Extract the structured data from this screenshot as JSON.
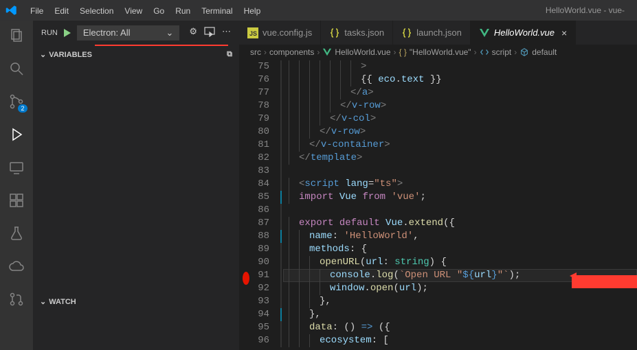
{
  "window_title": "HelloWorld.vue - vue-",
  "menu": [
    "File",
    "Edit",
    "Selection",
    "View",
    "Go",
    "Run",
    "Terminal",
    "Help"
  ],
  "activity_badge": "2",
  "run": {
    "label": "RUN",
    "config": "Electron: All"
  },
  "sections": {
    "variables": "VARIABLES",
    "watch": "WATCH"
  },
  "tabs": [
    {
      "label": "vue.config.js",
      "icon": "js",
      "active": false
    },
    {
      "label": "tasks.json",
      "icon": "json",
      "active": false
    },
    {
      "label": "launch.json",
      "icon": "json",
      "active": false
    },
    {
      "label": "HelloWorld.vue",
      "icon": "vue",
      "active": true
    }
  ],
  "breadcrumb": [
    "src",
    "components",
    "HelloWorld.vue",
    "\"HelloWorld.vue\"",
    "script",
    "default"
  ],
  "code": {
    "start": 75,
    "breakpoint_line": 91,
    "highlighted_line": 91,
    "modified_lines": [
      85,
      88,
      94
    ],
    "lines": [
      {
        "n": 75,
        "i": 7,
        "tokens": [
          [
            "c-pun",
            ">"
          ]
        ]
      },
      {
        "n": 76,
        "i": 7,
        "tokens": [
          [
            "c-plain",
            "{{ "
          ],
          [
            "c-var",
            "eco"
          ],
          [
            "c-plain",
            "."
          ],
          [
            "c-var",
            "text"
          ],
          [
            "c-plain",
            " }}"
          ]
        ]
      },
      {
        "n": 77,
        "i": 6,
        "tokens": [
          [
            "c-pun",
            "</"
          ],
          [
            "c-tag",
            "a"
          ],
          [
            "c-pun",
            ">"
          ]
        ]
      },
      {
        "n": 78,
        "i": 5,
        "tokens": [
          [
            "c-pun",
            "</"
          ],
          [
            "c-tag",
            "v-row"
          ],
          [
            "c-pun",
            ">"
          ]
        ]
      },
      {
        "n": 79,
        "i": 4,
        "tokens": [
          [
            "c-pun",
            "</"
          ],
          [
            "c-tag",
            "v-col"
          ],
          [
            "c-pun",
            ">"
          ]
        ]
      },
      {
        "n": 80,
        "i": 3,
        "tokens": [
          [
            "c-pun",
            "</"
          ],
          [
            "c-tag",
            "v-row"
          ],
          [
            "c-pun",
            ">"
          ]
        ]
      },
      {
        "n": 81,
        "i": 2,
        "tokens": [
          [
            "c-pun",
            "</"
          ],
          [
            "c-tag",
            "v-container"
          ],
          [
            "c-pun",
            ">"
          ]
        ]
      },
      {
        "n": 82,
        "i": 1,
        "tokens": [
          [
            "c-pun",
            "</"
          ],
          [
            "c-tag",
            "template"
          ],
          [
            "c-pun",
            ">"
          ]
        ]
      },
      {
        "n": 83,
        "i": 0,
        "tokens": []
      },
      {
        "n": 84,
        "i": 1,
        "tokens": [
          [
            "c-pun",
            "<"
          ],
          [
            "c-tag",
            "script "
          ],
          [
            "c-attr",
            "lang"
          ],
          [
            "c-plain",
            "="
          ],
          [
            "c-str",
            "\"ts\""
          ],
          [
            "c-pun",
            ">"
          ]
        ]
      },
      {
        "n": 85,
        "i": 1,
        "tokens": [
          [
            "c-kw",
            "import"
          ],
          [
            "c-plain",
            " "
          ],
          [
            "c-var",
            "Vue"
          ],
          [
            "c-plain",
            " "
          ],
          [
            "c-kw",
            "from"
          ],
          [
            "c-plain",
            " "
          ],
          [
            "c-str",
            "'vue'"
          ],
          [
            "c-plain",
            ";"
          ]
        ]
      },
      {
        "n": 86,
        "i": 0,
        "tokens": []
      },
      {
        "n": 87,
        "i": 1,
        "tokens": [
          [
            "c-kw",
            "export"
          ],
          [
            "c-plain",
            " "
          ],
          [
            "c-kw",
            "default"
          ],
          [
            "c-plain",
            " "
          ],
          [
            "c-var",
            "Vue"
          ],
          [
            "c-plain",
            "."
          ],
          [
            "c-fn",
            "extend"
          ],
          [
            "c-plain",
            "({"
          ]
        ]
      },
      {
        "n": 88,
        "i": 2,
        "tokens": [
          [
            "c-var",
            "name"
          ],
          [
            "c-plain",
            ": "
          ],
          [
            "c-str",
            "'HelloWorld'"
          ],
          [
            "c-plain",
            ","
          ]
        ]
      },
      {
        "n": 89,
        "i": 2,
        "tokens": [
          [
            "c-var",
            "methods"
          ],
          [
            "c-plain",
            ": {"
          ]
        ]
      },
      {
        "n": 90,
        "i": 3,
        "tokens": [
          [
            "c-fn",
            "openURL"
          ],
          [
            "c-plain",
            "("
          ],
          [
            "c-var",
            "url"
          ],
          [
            "c-plain",
            ": "
          ],
          [
            "c-type",
            "string"
          ],
          [
            "c-plain",
            ") {"
          ]
        ]
      },
      {
        "n": 91,
        "i": 4,
        "tokens": [
          [
            "c-var",
            "console"
          ],
          [
            "c-plain",
            "."
          ],
          [
            "c-fn",
            "log"
          ],
          [
            "c-plain",
            "("
          ],
          [
            "c-str",
            "`Open URL \""
          ],
          [
            "c-blue",
            "${"
          ],
          [
            "c-var",
            "url"
          ],
          [
            "c-blue",
            "}"
          ],
          [
            "c-str",
            "\"`"
          ],
          [
            "c-plain",
            ");"
          ]
        ]
      },
      {
        "n": 92,
        "i": 4,
        "tokens": [
          [
            "c-var",
            "window"
          ],
          [
            "c-plain",
            "."
          ],
          [
            "c-fn",
            "open"
          ],
          [
            "c-plain",
            "("
          ],
          [
            "c-var",
            "url"
          ],
          [
            "c-plain",
            ");"
          ]
        ]
      },
      {
        "n": 93,
        "i": 3,
        "tokens": [
          [
            "c-plain",
            "},"
          ]
        ]
      },
      {
        "n": 94,
        "i": 2,
        "tokens": [
          [
            "c-plain",
            "},"
          ]
        ]
      },
      {
        "n": 95,
        "i": 2,
        "tokens": [
          [
            "c-fn",
            "data"
          ],
          [
            "c-plain",
            ": () "
          ],
          [
            "c-blue",
            "=>"
          ],
          [
            "c-plain",
            " ({"
          ]
        ]
      },
      {
        "n": 96,
        "i": 3,
        "tokens": [
          [
            "c-var",
            "ecosystem"
          ],
          [
            "c-plain",
            ": ["
          ]
        ]
      }
    ]
  },
  "icons": {
    "gear": "⚙",
    "more": "⋯",
    "chevdown": "⌄",
    "chevright": "›",
    "copy": "⧉"
  }
}
